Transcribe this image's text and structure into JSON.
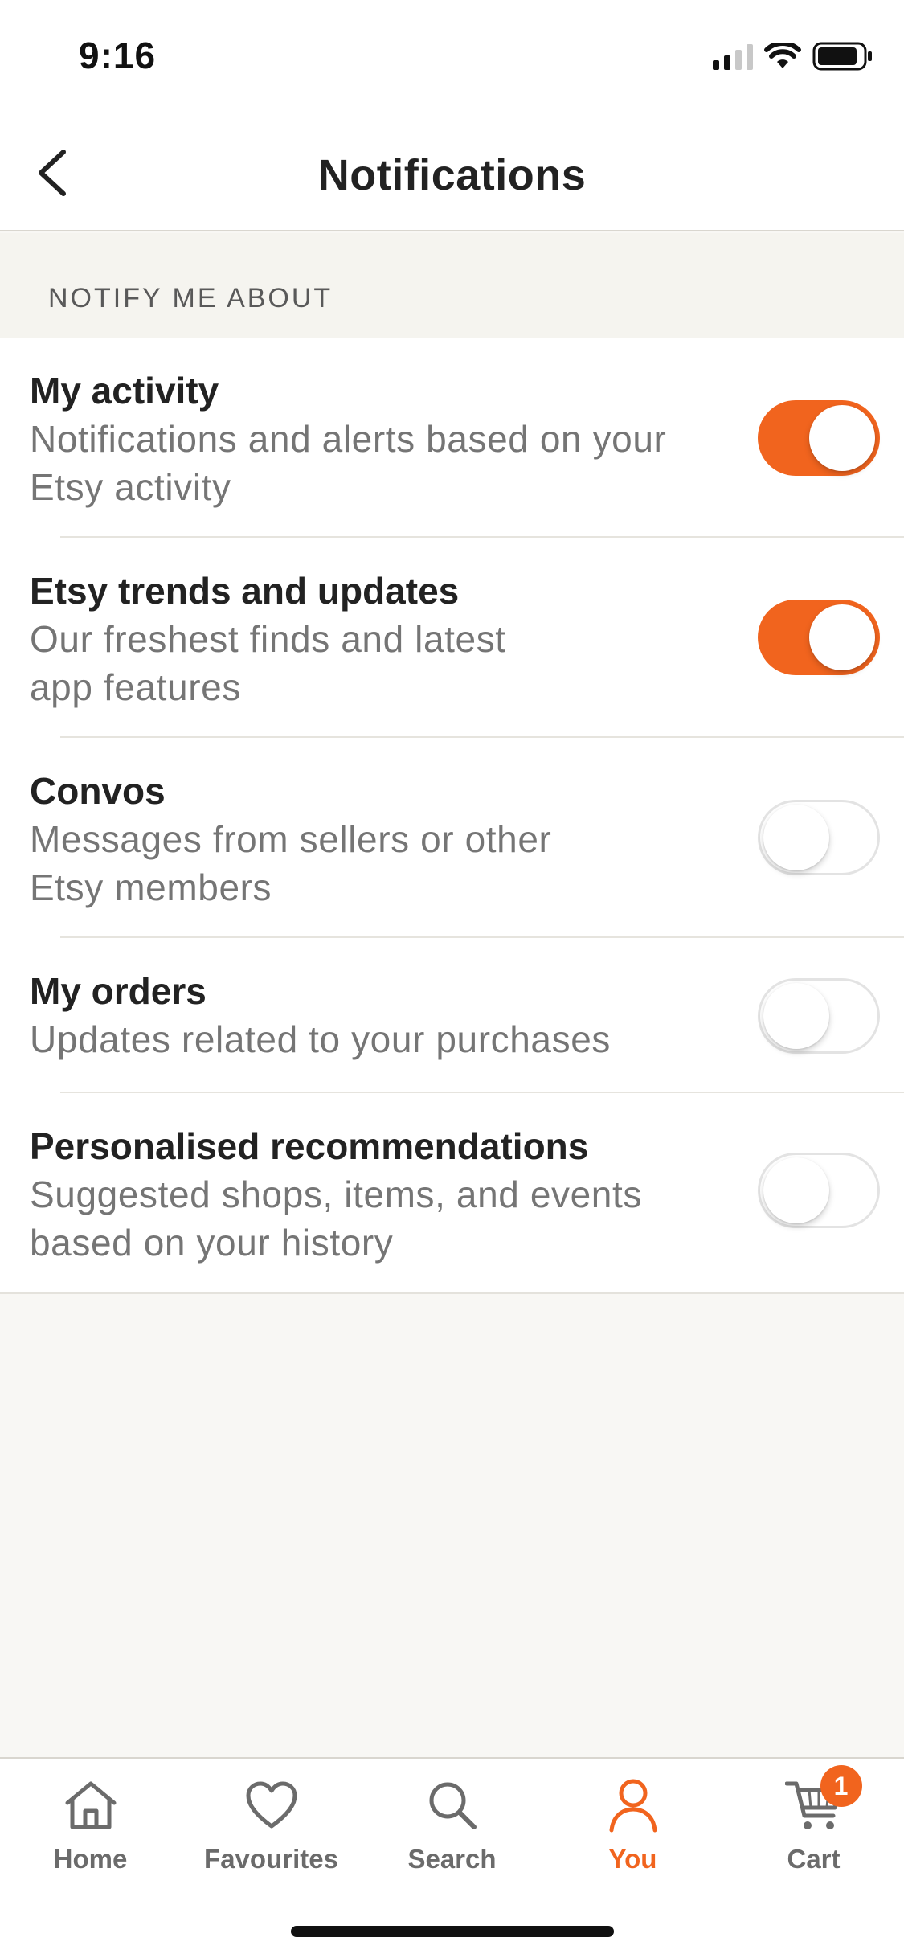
{
  "status_bar": {
    "time": "9:16"
  },
  "header": {
    "title": "Notifications"
  },
  "section": {
    "label": "NOTIFY ME ABOUT"
  },
  "settings": [
    {
      "title": "My activity",
      "desc_line1": "Notifications and alerts based on your",
      "desc_line2": "Etsy activity",
      "enabled": true
    },
    {
      "title": "Etsy trends and updates",
      "desc_line1": "Our freshest finds and latest",
      "desc_line2": "app features",
      "enabled": true
    },
    {
      "title": "Convos",
      "desc_line1": "Messages from sellers or other",
      "desc_line2": "Etsy members",
      "enabled": false
    },
    {
      "title": "My orders",
      "desc_line1": "Updates related to your purchases",
      "desc_line2": "",
      "enabled": false
    },
    {
      "title": "Personalised recommendations",
      "desc_line1": "Suggested shops, items, and events",
      "desc_line2": "based on your history",
      "enabled": false
    }
  ],
  "tabs": [
    {
      "label": "Home",
      "icon": "home-icon"
    },
    {
      "label": "Favourites",
      "icon": "heart-icon"
    },
    {
      "label": "Search",
      "icon": "search-icon"
    },
    {
      "label": "You",
      "icon": "person-icon",
      "active": true
    },
    {
      "label": "Cart",
      "icon": "cart-icon",
      "badge": "1"
    }
  ],
  "colors": {
    "accent": "#f1641e",
    "toggle_off": "#ffffff",
    "background": "#f8f7f4"
  }
}
